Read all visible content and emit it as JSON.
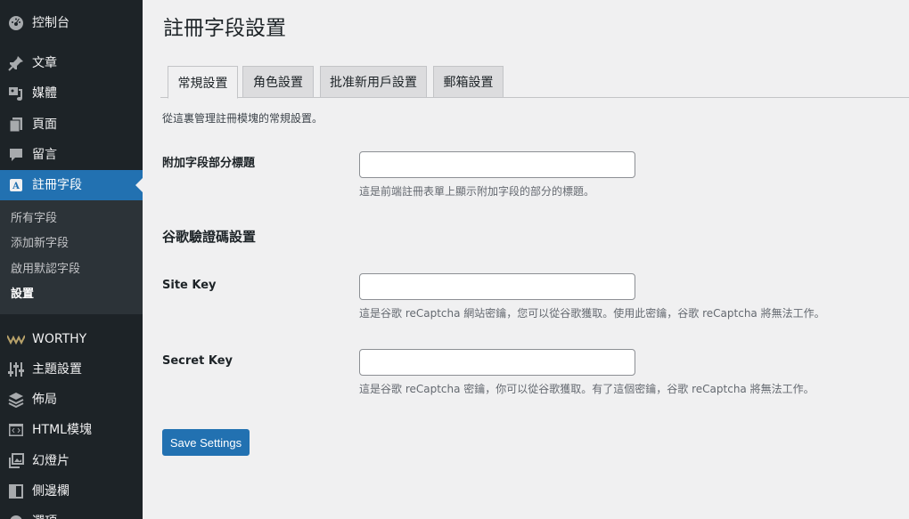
{
  "sidebar": {
    "items": [
      {
        "icon": "dashboard-icon",
        "label": "控制台"
      },
      {
        "icon": "pin-icon",
        "label": "文章"
      },
      {
        "icon": "media-icon",
        "label": "媒體"
      },
      {
        "icon": "page-icon",
        "label": "頁面"
      },
      {
        "icon": "comment-icon",
        "label": "留言"
      },
      {
        "icon": "registration-icon",
        "label": "註冊字段"
      },
      {
        "icon": "worthy-logo-icon",
        "label": "WORTHY"
      },
      {
        "icon": "sliders-icon",
        "label": "主題設置"
      },
      {
        "icon": "layers-icon",
        "label": "佈局"
      },
      {
        "icon": "code-icon",
        "label": "HTML模塊"
      },
      {
        "icon": "slides-icon",
        "label": "幻燈片"
      },
      {
        "icon": "sidebar-icon",
        "label": "側邊欄"
      },
      {
        "icon": "settings-icon",
        "label": "選項"
      }
    ],
    "active_index": 5,
    "submenu": [
      "所有字段",
      "添加新字段",
      "啟用默認字段",
      "設置"
    ],
    "submenu_current_index": 3
  },
  "page": {
    "title": "註冊字段設置",
    "tabs": [
      "常規設置",
      "角色設置",
      "批准新用戶設置",
      "郵箱設置"
    ],
    "active_tab_index": 0,
    "intro": "從這裏管理註冊模塊的常規設置。",
    "fields": {
      "section_title": {
        "label": "附加字段部分標題",
        "value": "",
        "help": "這是前端註冊表單上顯示附加字段的部分的標題。"
      },
      "recaptcha_heading": "谷歌驗證碼設置",
      "site_key": {
        "label": "Site Key",
        "value": "",
        "help": "這是谷歌 reCaptcha 網站密鑰，您可以從谷歌獲取。使用此密鑰，谷歌 reCaptcha 將無法工作。"
      },
      "secret_key": {
        "label": "Secret Key",
        "value": "",
        "help": "這是谷歌 reCaptcha 密鑰，你可以從谷歌獲取。有了這個密鑰，谷歌 reCaptcha 將無法工作。"
      }
    },
    "save_label": "Save Settings"
  },
  "colors": {
    "sidebar_bg": "#1d2327",
    "submenu_bg": "#2c3338",
    "accent": "#2271b1",
    "page_bg": "#f0f0f1"
  }
}
